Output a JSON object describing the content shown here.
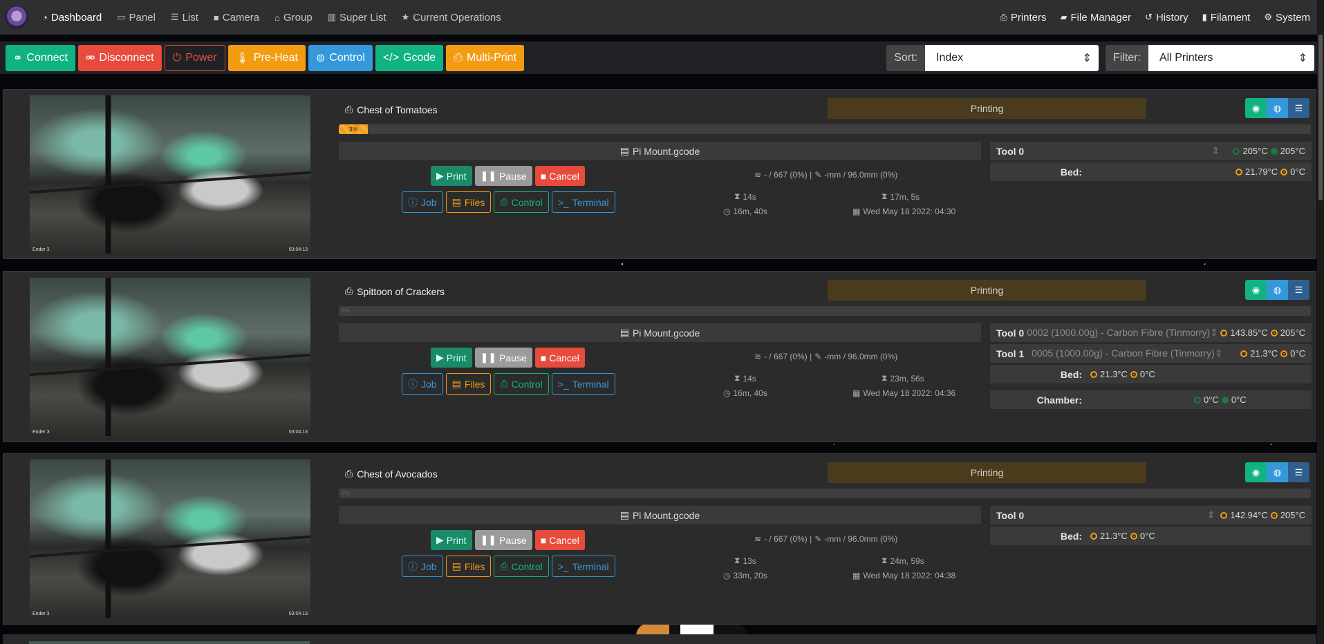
{
  "nav": {
    "left": [
      {
        "icon": "dashboard-icon",
        "label": "Dashboard"
      },
      {
        "icon": "panel-icon",
        "label": "Panel"
      },
      {
        "icon": "list-icon",
        "label": "List"
      },
      {
        "icon": "camera-icon",
        "label": "Camera"
      },
      {
        "icon": "group-icon",
        "label": "Group"
      },
      {
        "icon": "superlist-icon",
        "label": "Super List"
      },
      {
        "icon": "star-icon",
        "label": "Current Operations"
      }
    ],
    "right": [
      {
        "icon": "printer-icon",
        "label": "Printers"
      },
      {
        "icon": "folder-icon",
        "label": "File Manager"
      },
      {
        "icon": "history-icon",
        "label": "History"
      },
      {
        "icon": "filament-icon",
        "label": "Filament"
      },
      {
        "icon": "gear-icon",
        "label": "System"
      }
    ]
  },
  "toolbar": {
    "connect": "Connect",
    "disconnect": "Disconnect",
    "power": "Power",
    "preheat": "Pre-Heat",
    "control": "Control",
    "gcode": "Gcode",
    "multiprint": "Multi-Print",
    "sort_label": "Sort:",
    "sort_value": "Index",
    "filter_label": "Filter:",
    "filter_value": "All Printers"
  },
  "colors": {
    "accent_green": "#12b382",
    "accent_red": "#e64b3b",
    "accent_orange": "#f39c12",
    "accent_blue": "#3498db",
    "status_bg": "#4a3b1d"
  },
  "printers": [
    {
      "name": "Chest of Tomatoes",
      "status": "Printing",
      "progress": 3,
      "progress_label": "3%",
      "file": "Pi Mount.gcode",
      "buttons": {
        "print": "Print",
        "pause": "Pause",
        "cancel": "Cancel",
        "job": "Job",
        "files": "Files",
        "control": "Control",
        "terminal": "Terminal"
      },
      "layers": "- / 667 (0%) |",
      "height": "-mm / 96.0mm (0%)",
      "elapsed": "14s",
      "remaining": "17m, 5s",
      "total": "16m, 40s",
      "eta": "Wed May 18 2022: 04:30",
      "camera_stamp_left": "Ender 3",
      "camera_stamp_right": "03:04:13",
      "tools": [
        {
          "label": "Tool 0",
          "spool": "",
          "actual": "205°C",
          "target": "205°C",
          "state": "ready"
        }
      ],
      "bed": {
        "label": "Bed:",
        "actual": "21.79°C",
        "target": "0°C"
      }
    },
    {
      "name": "Spittoon of Crackers",
      "status": "Printing",
      "progress": 0,
      "progress_label": "0%",
      "file": "Pi Mount.gcode",
      "buttons": {
        "print": "Print",
        "pause": "Pause",
        "cancel": "Cancel",
        "job": "Job",
        "files": "Files",
        "control": "Control",
        "terminal": "Terminal"
      },
      "layers": "- / 667 (0%) |",
      "height": "-mm / 96.0mm (0%)",
      "elapsed": "14s",
      "remaining": "23m, 56s",
      "total": "16m, 40s",
      "eta": "Wed May 18 2022: 04:36",
      "camera_stamp_left": "Ender 3",
      "camera_stamp_right": "03:04:13",
      "tools": [
        {
          "label": "Tool 0",
          "spool": "0002 (1000.00g) - Carbon Fibre (Tinmorry)",
          "actual": "143.85°C",
          "target": "205°C",
          "state": "heating"
        },
        {
          "label": "Tool 1",
          "spool": "0005 (1000.00g) - Carbon Fibre (Tinmorry)",
          "actual": "21.3°C",
          "target": "0°C",
          "state": "heating"
        }
      ],
      "bed": {
        "label": "Bed:",
        "actual": "21.3°C",
        "target": "0°C"
      },
      "chamber": {
        "label": "Chamber:",
        "actual": "0°C",
        "target": "0°C"
      }
    },
    {
      "name": "Chest of Avocados",
      "status": "Printing",
      "progress": 0,
      "progress_label": "0%",
      "file": "Pi Mount.gcode",
      "buttons": {
        "print": "Print",
        "pause": "Pause",
        "cancel": "Cancel",
        "job": "Job",
        "files": "Files",
        "control": "Control",
        "terminal": "Terminal"
      },
      "layers": "- / 667 (0%) |",
      "height": "-mm / 96.0mm (0%)",
      "elapsed": "13s",
      "remaining": "24m, 59s",
      "total": "33m, 20s",
      "eta": "Wed May 18 2022: 04:38",
      "camera_stamp_left": "Ender 3",
      "camera_stamp_right": "03:04:13",
      "tools": [
        {
          "label": "Tool 0",
          "spool": "",
          "actual": "142.94°C",
          "target": "205°C",
          "state": "heating"
        }
      ],
      "bed": {
        "label": "Bed:",
        "actual": "21.3°C",
        "target": "0°C"
      }
    }
  ]
}
